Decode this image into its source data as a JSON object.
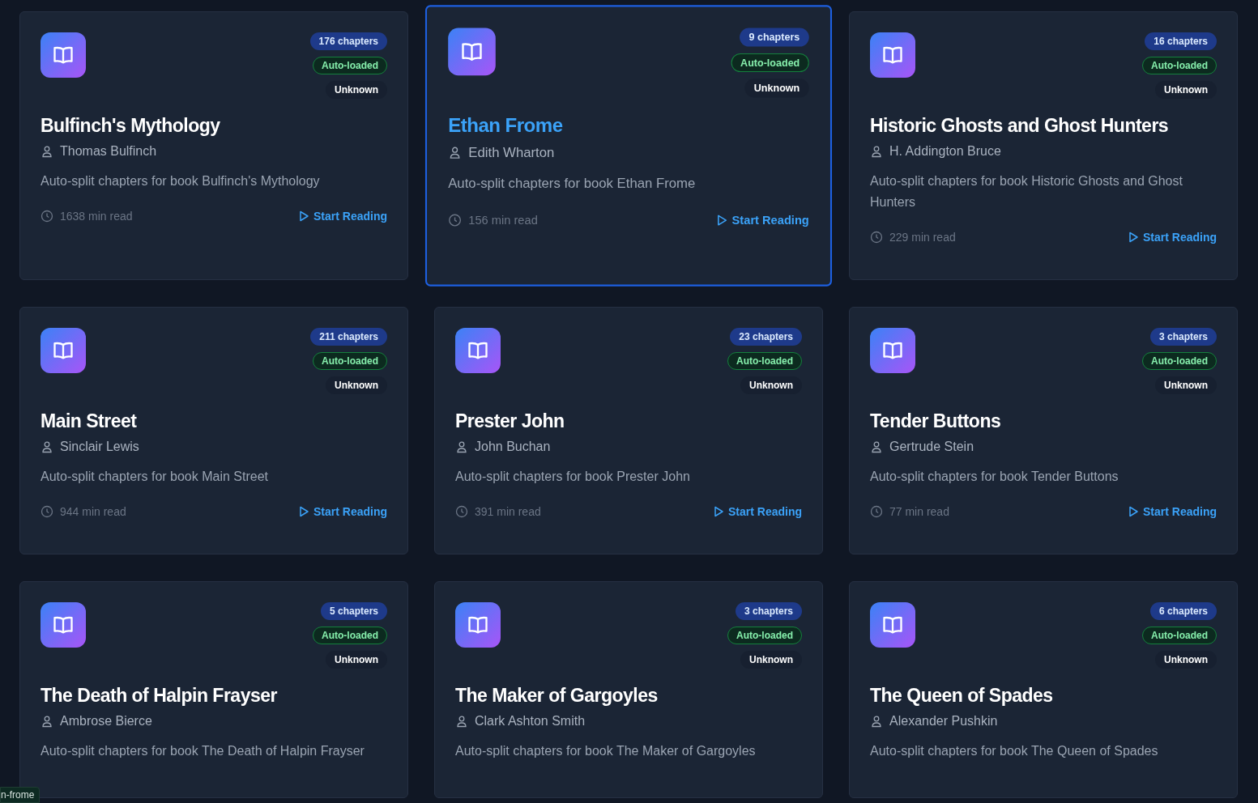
{
  "books": [
    {
      "title": "Bulfinch's Mythology",
      "author": "Thomas Bulfinch",
      "chapters": "176 chapters",
      "source": "Auto-loaded",
      "status": "Unknown",
      "description": "Auto-split chapters for book Bulfinch's Mythology",
      "read_time": "1638 min read",
      "action": "Start Reading",
      "selected": false
    },
    {
      "title": "Ethan Frome",
      "author": "Edith Wharton",
      "chapters": "9 chapters",
      "source": "Auto-loaded",
      "status": "Unknown",
      "description": "Auto-split chapters for book Ethan Frome",
      "read_time": "156 min read",
      "action": "Start Reading",
      "selected": true
    },
    {
      "title": "Historic Ghosts and Ghost Hunters",
      "author": "H. Addington Bruce",
      "chapters": "16 chapters",
      "source": "Auto-loaded",
      "status": "Unknown",
      "description": "Auto-split chapters for book Historic Ghosts and Ghost Hunters",
      "read_time": "229 min read",
      "action": "Start Reading",
      "selected": false
    },
    {
      "title": "Main Street",
      "author": "Sinclair Lewis",
      "chapters": "211 chapters",
      "source": "Auto-loaded",
      "status": "Unknown",
      "description": "Auto-split chapters for book Main Street",
      "read_time": "944 min read",
      "action": "Start Reading",
      "selected": false
    },
    {
      "title": "Prester John",
      "author": "John Buchan",
      "chapters": "23 chapters",
      "source": "Auto-loaded",
      "status": "Unknown",
      "description": "Auto-split chapters for book Prester John",
      "read_time": "391 min read",
      "action": "Start Reading",
      "selected": false
    },
    {
      "title": "Tender Buttons",
      "author": "Gertrude Stein",
      "chapters": "3 chapters",
      "source": "Auto-loaded",
      "status": "Unknown",
      "description": "Auto-split chapters for book Tender Buttons",
      "read_time": "77 min read",
      "action": "Start Reading",
      "selected": false
    },
    {
      "title": "The Death of Halpin Frayser",
      "author": "Ambrose Bierce",
      "chapters": "5 chapters",
      "source": "Auto-loaded",
      "status": "Unknown",
      "description": "Auto-split chapters for book The Death of Halpin Frayser",
      "selected": false
    },
    {
      "title": "The Maker of Gargoyles",
      "author": "Clark Ashton Smith",
      "chapters": "3 chapters",
      "source": "Auto-loaded",
      "status": "Unknown",
      "description": "Auto-split chapters for book The Maker of Gargoyles",
      "selected": false
    },
    {
      "title": "The Queen of Spades",
      "author": "Alexander Pushkin",
      "chapters": "6 chapters",
      "source": "Auto-loaded",
      "status": "Unknown",
      "description": "Auto-split chapters for book The Queen of Spades",
      "selected": false
    }
  ],
  "tooltip": "n-frome"
}
